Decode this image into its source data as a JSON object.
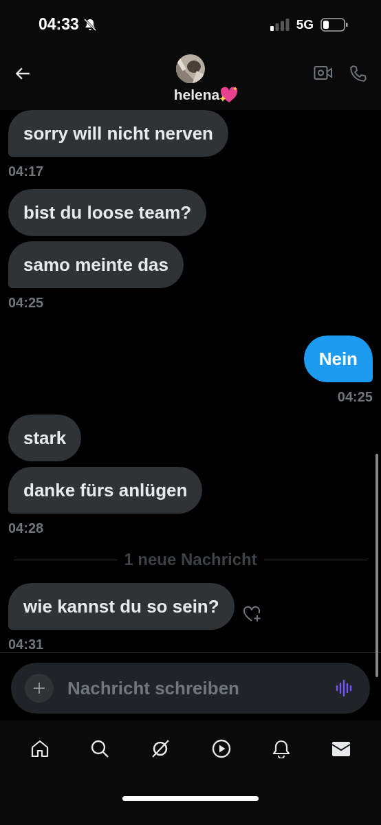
{
  "status_bar": {
    "time": "04:33",
    "network": "5G"
  },
  "header": {
    "name": "helena"
  },
  "messages": [
    {
      "kind": "received",
      "bubbles": [
        {
          "text": "sorry will nicht nerven",
          "react": false
        }
      ],
      "time": "04:17"
    },
    {
      "kind": "received",
      "bubbles": [
        {
          "text": "bist du loose team?",
          "react": false
        },
        {
          "text": "samo meinte das",
          "react": false
        }
      ],
      "time": "04:25"
    },
    {
      "kind": "sent",
      "bubbles": [
        {
          "text": "Nein",
          "react": false
        }
      ],
      "time": "04:25"
    },
    {
      "kind": "received",
      "bubbles": [
        {
          "text": "stark",
          "react": false
        },
        {
          "text": "danke fürs anlügen",
          "react": false
        }
      ],
      "time": "04:28"
    },
    {
      "kind": "divider",
      "text": "1 neue Nachricht"
    },
    {
      "kind": "received",
      "bubbles": [
        {
          "text": "wie kannst du so sein?",
          "react": true
        }
      ],
      "time": "04:31"
    }
  ],
  "composer": {
    "placeholder": "Nachricht schreiben"
  }
}
